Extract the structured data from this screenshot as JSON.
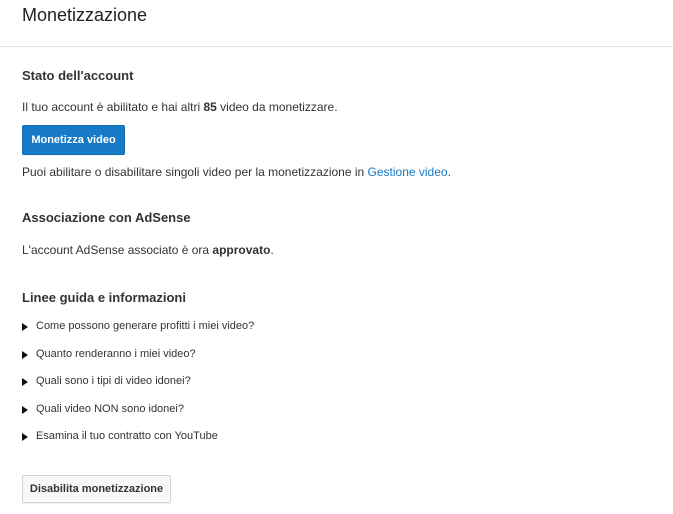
{
  "header": {
    "title": "Monetizzazione"
  },
  "account_status": {
    "title": "Stato dell'account",
    "line_before": "Il tuo account è abilitato e hai altri ",
    "video_count": "85",
    "line_after": " video da monetizzare.",
    "monetize_button": "Monetizza video",
    "manage_before": "Puoi abilitare o disabilitare singoli video per la monetizzazione in ",
    "manage_link": "Gestione video",
    "manage_after": "."
  },
  "adsense": {
    "title": "Associazione con AdSense",
    "line_before": "L'account AdSense associato è ora ",
    "status": "approvato",
    "line_after": "."
  },
  "guidelines": {
    "title": "Linee guida e informazioni",
    "items": [
      {
        "label": "Come possono generare profitti i miei video?"
      },
      {
        "label": "Quanto renderanno i miei video?"
      },
      {
        "label": "Quali sono i tipi di video idonei?"
      },
      {
        "label": "Quali video NON sono idonei?"
      },
      {
        "label": "Esamina il tuo contratto con YouTube"
      }
    ]
  },
  "footer": {
    "disable_button": "Disabilita monetizzazione"
  },
  "colors": {
    "accent": "#167ac6",
    "divider": "#e2e2e2",
    "text": "#333333"
  }
}
